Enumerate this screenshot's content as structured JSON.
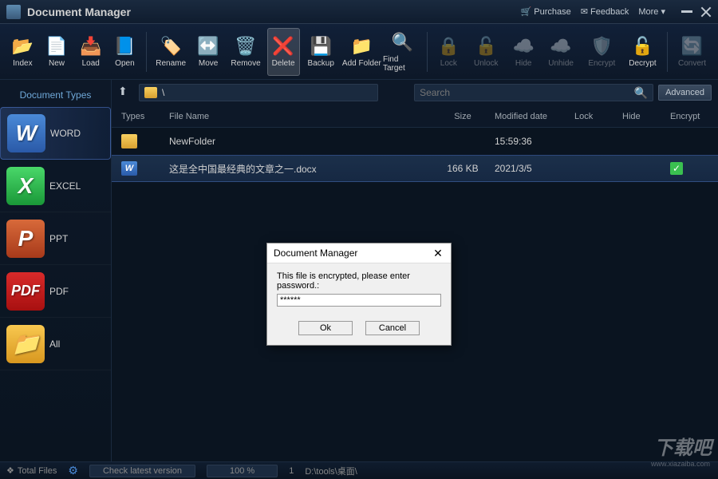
{
  "title": "Document Manager",
  "title_links": {
    "purchase": "Purchase",
    "feedback": "Feedback",
    "more": "More ▾"
  },
  "toolbar": [
    {
      "key": "index",
      "label": "Index",
      "glyph": "📂",
      "wide": false
    },
    {
      "key": "new",
      "label": "New",
      "glyph": "📄",
      "wide": false
    },
    {
      "key": "load",
      "label": "Load",
      "glyph": "📥",
      "wide": false
    },
    {
      "key": "open",
      "label": "Open",
      "glyph": "📘",
      "wide": false
    },
    {
      "sep": true
    },
    {
      "key": "rename",
      "label": "Rename",
      "glyph": "🏷️",
      "wide": true
    },
    {
      "key": "move",
      "label": "Move",
      "glyph": "↔️",
      "wide": false
    },
    {
      "key": "remove",
      "label": "Remove",
      "glyph": "🗑️",
      "wide": true
    },
    {
      "key": "delete",
      "label": "Delete",
      "glyph": "❌",
      "wide": false,
      "active": true
    },
    {
      "key": "backup",
      "label": "Backup",
      "glyph": "💾",
      "wide": true
    },
    {
      "key": "addfolder",
      "label": "Add Folder",
      "glyph": "📁",
      "wide": true
    },
    {
      "key": "findtarget",
      "label": "Find Target",
      "glyph": "🔍",
      "wide": true
    },
    {
      "sep": true
    },
    {
      "key": "lock",
      "label": "Lock",
      "glyph": "🔒",
      "wide": false,
      "disabled": true
    },
    {
      "key": "unlock",
      "label": "Unlock",
      "glyph": "🔓",
      "wide": true,
      "disabled": true
    },
    {
      "key": "hide",
      "label": "Hide",
      "glyph": "☁️",
      "wide": false,
      "disabled": true
    },
    {
      "key": "unhide",
      "label": "Unhide",
      "glyph": "☁️",
      "wide": true,
      "disabled": true
    },
    {
      "key": "encrypt",
      "label": "Encrypt",
      "glyph": "🛡️",
      "wide": true,
      "disabled": true
    },
    {
      "key": "decrypt",
      "label": "Decrypt",
      "glyph": "🔓",
      "wide": true
    },
    {
      "sep": true
    },
    {
      "key": "convert",
      "label": "Convert",
      "glyph": "🔄",
      "wide": true,
      "disabled": true
    }
  ],
  "sidebar": {
    "header": "Document Types",
    "items": [
      {
        "label": "WORD",
        "cls": "si-word",
        "glyph": "W",
        "active": true
      },
      {
        "label": "EXCEL",
        "cls": "si-excel",
        "glyph": "X"
      },
      {
        "label": "PPT",
        "cls": "si-ppt",
        "glyph": "P"
      },
      {
        "label": "PDF",
        "cls": "si-pdf",
        "glyph": "PDF"
      },
      {
        "label": "All",
        "cls": "si-all",
        "glyph": "📁"
      }
    ]
  },
  "path": "\\",
  "search_placeholder": "Search",
  "advanced_label": "Advanced",
  "columns": {
    "types": "Types",
    "name": "File Name",
    "size": "Size",
    "mod": "Modified date",
    "lock": "Lock",
    "hide": "Hide",
    "enc": "Encrypt"
  },
  "rows": [
    {
      "type": "folder",
      "name": "NewFolder",
      "size": "",
      "mod": "15:59:36",
      "enc": false,
      "selected": false
    },
    {
      "type": "word",
      "name": "这是全中国最经典的文章之一.docx",
      "size": "166 KB",
      "mod": "2021/3/5",
      "enc": true,
      "selected": true
    }
  ],
  "dialog": {
    "title": "Document Manager",
    "message": "This file is encrypted, please enter password.:",
    "input_value": "******",
    "ok": "Ok",
    "cancel": "Cancel"
  },
  "status": {
    "total_files": "Total Files",
    "check": "Check latest version",
    "progress": "100 %",
    "count": "1",
    "path": "D:\\tools\\桌面\\"
  },
  "watermark": {
    "main": "下载吧",
    "sub": "www.xiazaiba.com"
  }
}
